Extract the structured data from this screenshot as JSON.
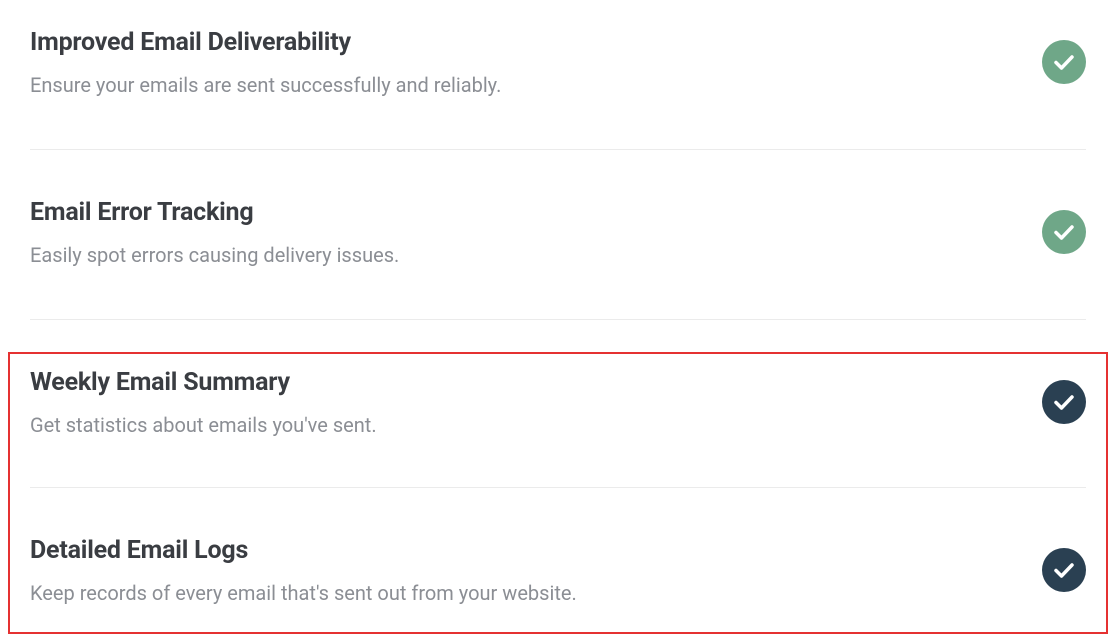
{
  "features": [
    {
      "title": "Improved Email Deliverability",
      "description": "Ensure your emails are sent successfully and reliably.",
      "badge_color": "green"
    },
    {
      "title": "Email Error Tracking",
      "description": "Easily spot errors causing delivery issues.",
      "badge_color": "green"
    },
    {
      "title": "Weekly Email Summary",
      "description": "Get statistics about emails you've sent.",
      "badge_color": "dark"
    },
    {
      "title": "Detailed Email Logs",
      "description": "Keep records of every email that's sent out from your website.",
      "badge_color": "dark"
    }
  ],
  "highlight": {
    "color": "#e53131"
  }
}
